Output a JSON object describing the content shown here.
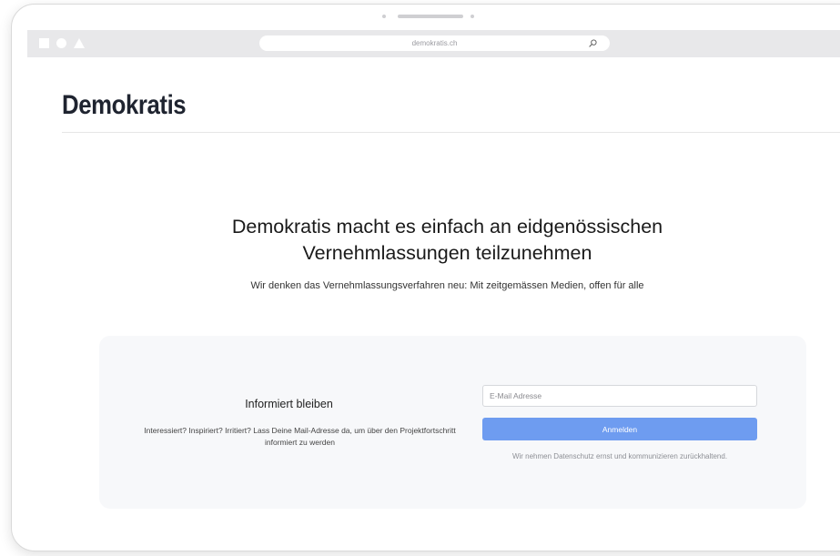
{
  "browser": {
    "url": "demokratis.ch"
  },
  "site": {
    "logo_text": "Demokratis"
  },
  "hero": {
    "title_line1": "Demokratis macht es einfach an eidgenössischen",
    "title_line2": "Vernehmlassungen teilzunehmen",
    "subtitle": "Wir denken das Vernehmlassungsverfahren neu: Mit zeitgemässen Medien, offen für alle"
  },
  "signup": {
    "title": "Informiert bleiben",
    "description": "Interessiert? Inspiriert? Irritiert? Lass Deine Mail-Adresse da, um über den Projektfortschritt informiert zu werden",
    "email_placeholder": "E-Mail Adresse",
    "email_value": "",
    "button_label": "Anmelden",
    "privacy_note": "Wir nehmen Datenschutz ernst und kommunizieren zurückhaltend."
  },
  "colors": {
    "accent": "#6e9cf0",
    "chrome": "#e8e8ea",
    "card_bg": "#f7f8fa",
    "logo": "#1f2430"
  },
  "icons": {
    "window_controls": [
      "square-icon",
      "circle-icon",
      "triangle-icon"
    ],
    "url_search": "search-icon"
  }
}
